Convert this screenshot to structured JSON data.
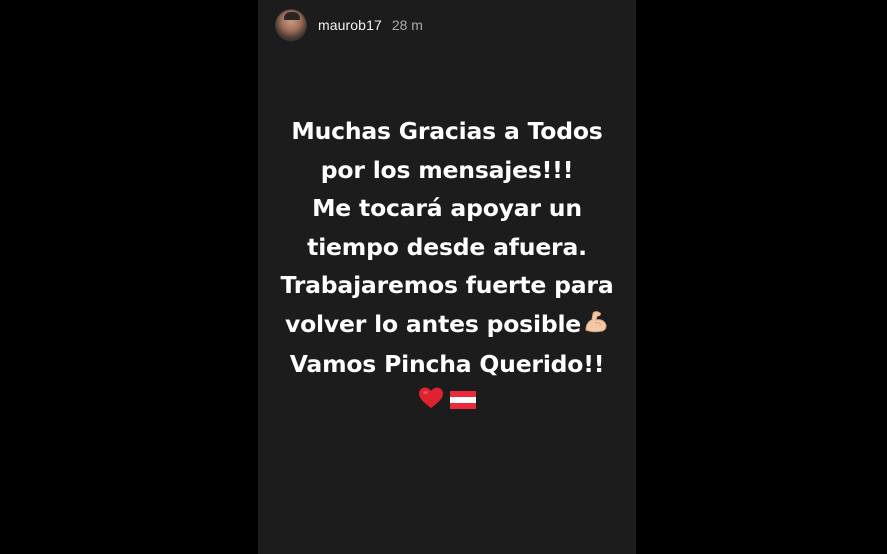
{
  "story": {
    "username": "maurob17",
    "time_ago": "28 m",
    "lines": [
      "Muchas Gracias a Todos",
      "por los mensajes!!!",
      "Me tocará apoyar un",
      "tiempo desde afuera.",
      "Trabajaremos fuerte para",
      "volver lo antes posible",
      "Vamos Pincha Querido!!"
    ],
    "emojis": {
      "muscle": "flexed-biceps-icon",
      "heart": "red-heart-icon",
      "flag": "austria-flag-icon"
    },
    "colors": {
      "story_background": "#1c1c1c",
      "outer_background": "#000000",
      "text": "#ffffff",
      "heart": "#e0212f",
      "flag_red": "#ed2939"
    }
  }
}
